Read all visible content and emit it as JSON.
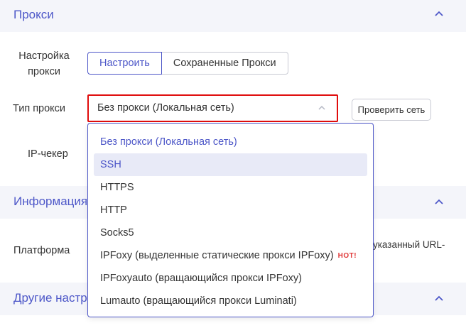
{
  "sections": {
    "proxy": {
      "title": "Прокси"
    },
    "info": {
      "title": "Информация"
    },
    "other": {
      "title": "Другие настр"
    }
  },
  "labels": {
    "proxy_setup_line1": "Настройка",
    "proxy_setup_line2": "прокси",
    "proxy_type": "Тип прокси",
    "ip_checker": "IP-чекер",
    "platform": "Платформа"
  },
  "segment": {
    "configure": "Настроить",
    "saved": "Сохраненные Прокси"
  },
  "proxy_type_select": {
    "value": "Без прокси (Локальная сеть)"
  },
  "check_network_button": "Проверить сеть",
  "platform_hint_line1": "ть указанный URL-",
  "platform_hint_line2": "",
  "dropdown": {
    "options": [
      {
        "label": "Без прокси (Локальная сеть)",
        "badge": ""
      },
      {
        "label": "SSH",
        "badge": ""
      },
      {
        "label": "HTTPS",
        "badge": ""
      },
      {
        "label": "HTTP",
        "badge": ""
      },
      {
        "label": "Socks5",
        "badge": ""
      },
      {
        "label": "IPFoxy (выделенные статические прокси IPFoxy)",
        "badge": "HOT!"
      },
      {
        "label": "IPFoxyauto (вращающийся прокси IPFoxy)",
        "badge": ""
      },
      {
        "label": "Lumauto (вращающийся прокси Luminati)",
        "badge": ""
      }
    ]
  },
  "colors": {
    "accent": "#4d57c8",
    "section_bg": "#f4f5fa",
    "highlight_border": "#e00d0d",
    "hot_badge": "#e03a3a",
    "hover_bg": "#e8eaf7"
  }
}
